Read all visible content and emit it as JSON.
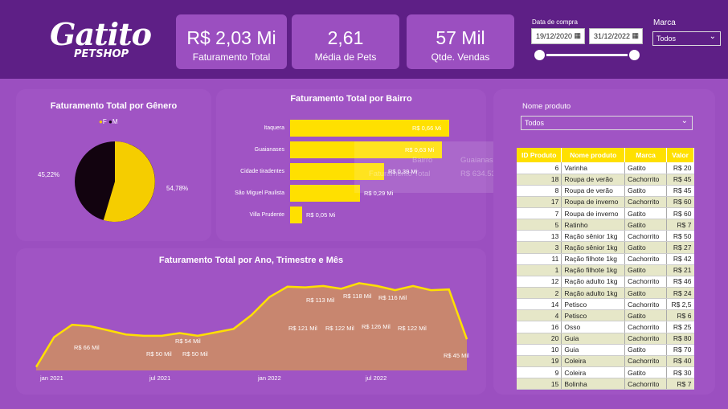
{
  "logo": {
    "text": "Gatito",
    "subtext": "PETSHOP"
  },
  "kpis": [
    {
      "value": "R$ 2,03 Mi",
      "label": "Faturamento Total"
    },
    {
      "value": "2,61",
      "label": "Média de Pets"
    },
    {
      "value": "57 Mil",
      "label": "Qtde. Vendas"
    }
  ],
  "filters": {
    "date_label": "Data de compra",
    "date_start": "19/12/2020",
    "date_end": "31/12/2022",
    "slider_range": [
      0,
      1
    ],
    "marca_label": "Marca",
    "marca_value": "Todos"
  },
  "icons": {
    "calendar": "calendar-icon",
    "chevron": "chevron-down-icon"
  },
  "colors": {
    "accent": "#ffe000",
    "bar_dark": "#5e1f86",
    "bg": "#9b4fc0",
    "panel": "#a054c4",
    "pie_f": "#f5cd00",
    "pie_m": "#12030f",
    "area": "#c8866f"
  },
  "gender_chart": {
    "title": "Faturamento Total por Gênero",
    "legend_f": "F",
    "legend_m": "M",
    "label_m": "45,22%",
    "label_f": "54,78%"
  },
  "bairro_chart": {
    "title": "Faturamento Total por Bairro",
    "rows": [
      {
        "name": "Itaquera",
        "label": "R$ 0,66 Mi"
      },
      {
        "name": "Guaianases",
        "label": "R$ 0,63 Mi"
      },
      {
        "name": "Cidade tiradentes",
        "label": "R$ 0,39 Mi"
      },
      {
        "name": "São Miguel Paulista",
        "label": "R$ 0,29 Mi"
      },
      {
        "name": "Villa Prudente",
        "label": "R$ 0,05 Mi"
      }
    ],
    "tooltip": {
      "k1": "Bairro",
      "v1": "Guaianases",
      "k2": "Faturamento Total",
      "v2": "R$ 634.531"
    }
  },
  "time_chart": {
    "title": "Faturamento Total por Ano, Trimestre e Mês",
    "xticks": [
      "jan 2021",
      "jul 2021",
      "jan 2022",
      "jul 2022"
    ],
    "labels": [
      "R$ 66 Mil",
      "R$ 50 Mil",
      "R$ 50 Mil",
      "R$ 54 Mil",
      "R$ 121 Mil",
      "R$ 122 Mil",
      "R$ 126 Mil",
      "R$ 122 Mil",
      "R$ 113 Mil",
      "R$ 118 Mil",
      "R$ 116 Mil",
      "R$ 45 Mil"
    ]
  },
  "products": {
    "filter_label": "Nome produto",
    "filter_value": "Todos",
    "headers": [
      "ID Produto",
      "Nome produto",
      "Marca",
      "Valor"
    ],
    "rows": [
      [
        "6",
        "Varinha",
        "Gatito",
        "R$ 20"
      ],
      [
        "18",
        "Roupa de verão",
        "Cachorrito",
        "R$ 45"
      ],
      [
        "8",
        "Roupa de verão",
        "Gatito",
        "R$ 45"
      ],
      [
        "17",
        "Roupa de inverno",
        "Cachorrito",
        "R$ 60"
      ],
      [
        "7",
        "Roupa de inverno",
        "Gatito",
        "R$ 60"
      ],
      [
        "5",
        "Ratinho",
        "Gatito",
        "R$ 7"
      ],
      [
        "13",
        "Ração sênior 1kg",
        "Cachorrito",
        "R$ 50"
      ],
      [
        "3",
        "Ração sênior 1kg",
        "Gatito",
        "R$ 27"
      ],
      [
        "11",
        "Ração filhote 1kg",
        "Cachorrito",
        "R$ 42"
      ],
      [
        "1",
        "Ração filhote 1kg",
        "Gatito",
        "R$ 21"
      ],
      [
        "12",
        "Ração adulto 1kg",
        "Cachorrito",
        "R$ 46"
      ],
      [
        "2",
        "Ração adulto 1kg",
        "Gatito",
        "R$ 24"
      ],
      [
        "14",
        "Petisco",
        "Cachorrito",
        "R$ 2,5"
      ],
      [
        "4",
        "Petisco",
        "Gatito",
        "R$ 6"
      ],
      [
        "16",
        "Osso",
        "Cachorrito",
        "R$ 25"
      ],
      [
        "20",
        "Guia",
        "Cachorrito",
        "R$ 80"
      ],
      [
        "10",
        "Guia",
        "Gatito",
        "R$ 70"
      ],
      [
        "19",
        "Coleira",
        "Cachorrito",
        "R$ 40"
      ],
      [
        "9",
        "Coleira",
        "Gatito",
        "R$ 30"
      ],
      [
        "15",
        "Bolinha",
        "Cachorrito",
        "R$ 7"
      ]
    ]
  },
  "chart_data": [
    {
      "type": "pie",
      "title": "Faturamento Total por Gênero",
      "categories": [
        "F",
        "M"
      ],
      "values": [
        54.78,
        45.22
      ],
      "legend": "top"
    },
    {
      "type": "bar",
      "title": "Faturamento Total por Bairro",
      "categories": [
        "Itaquera",
        "Guaianases",
        "Cidade tiradentes",
        "São Miguel Paulista",
        "Villa Prudente"
      ],
      "values": [
        0.66,
        0.63,
        0.39,
        0.29,
        0.05
      ],
      "orientation": "horizontal"
    },
    {
      "type": "area",
      "title": "Faturamento Total por Ano, Trimestre e Mês",
      "x": [
        "dez 2020",
        "jan 2021",
        "fev 2021",
        "mar 2021",
        "abr 2021",
        "mai 2021",
        "jun 2021",
        "jul 2021",
        "ago 2021",
        "set 2021",
        "out 2021",
        "nov 2021",
        "dez 2021",
        "jan 2022",
        "fev 2022",
        "mar 2022",
        "abr 2022",
        "mai 2022",
        "jun 2022",
        "jul 2022",
        "ago 2022",
        "set 2022",
        "out 2022",
        "nov 2022",
        "dez 2022"
      ],
      "values": [
        5,
        48,
        66,
        64,
        58,
        52,
        50,
        50,
        54,
        50,
        55,
        60,
        80,
        106,
        121,
        120,
        122,
        118,
        126,
        122,
        116,
        122,
        116,
        117,
        45
      ]
    }
  ]
}
